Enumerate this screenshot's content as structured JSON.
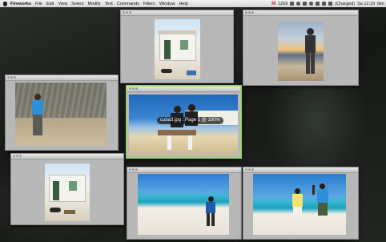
{
  "menubar": {
    "app_name": "Fireworks",
    "menus": [
      "File",
      "Edit",
      "View",
      "Select",
      "Modify",
      "Text",
      "Commands",
      "Filters",
      "Window",
      "Help"
    ],
    "gmail_count": "1209",
    "input_mode": "(Charged)",
    "clock": "Sa 12:19",
    "user": "Ikm"
  },
  "expose": {
    "hover_caption": "cuba3.jpg : Page 1 @ 100%"
  },
  "colors": {
    "active_window_border": "#9ed36b",
    "gmail_red": "#cc2222"
  }
}
